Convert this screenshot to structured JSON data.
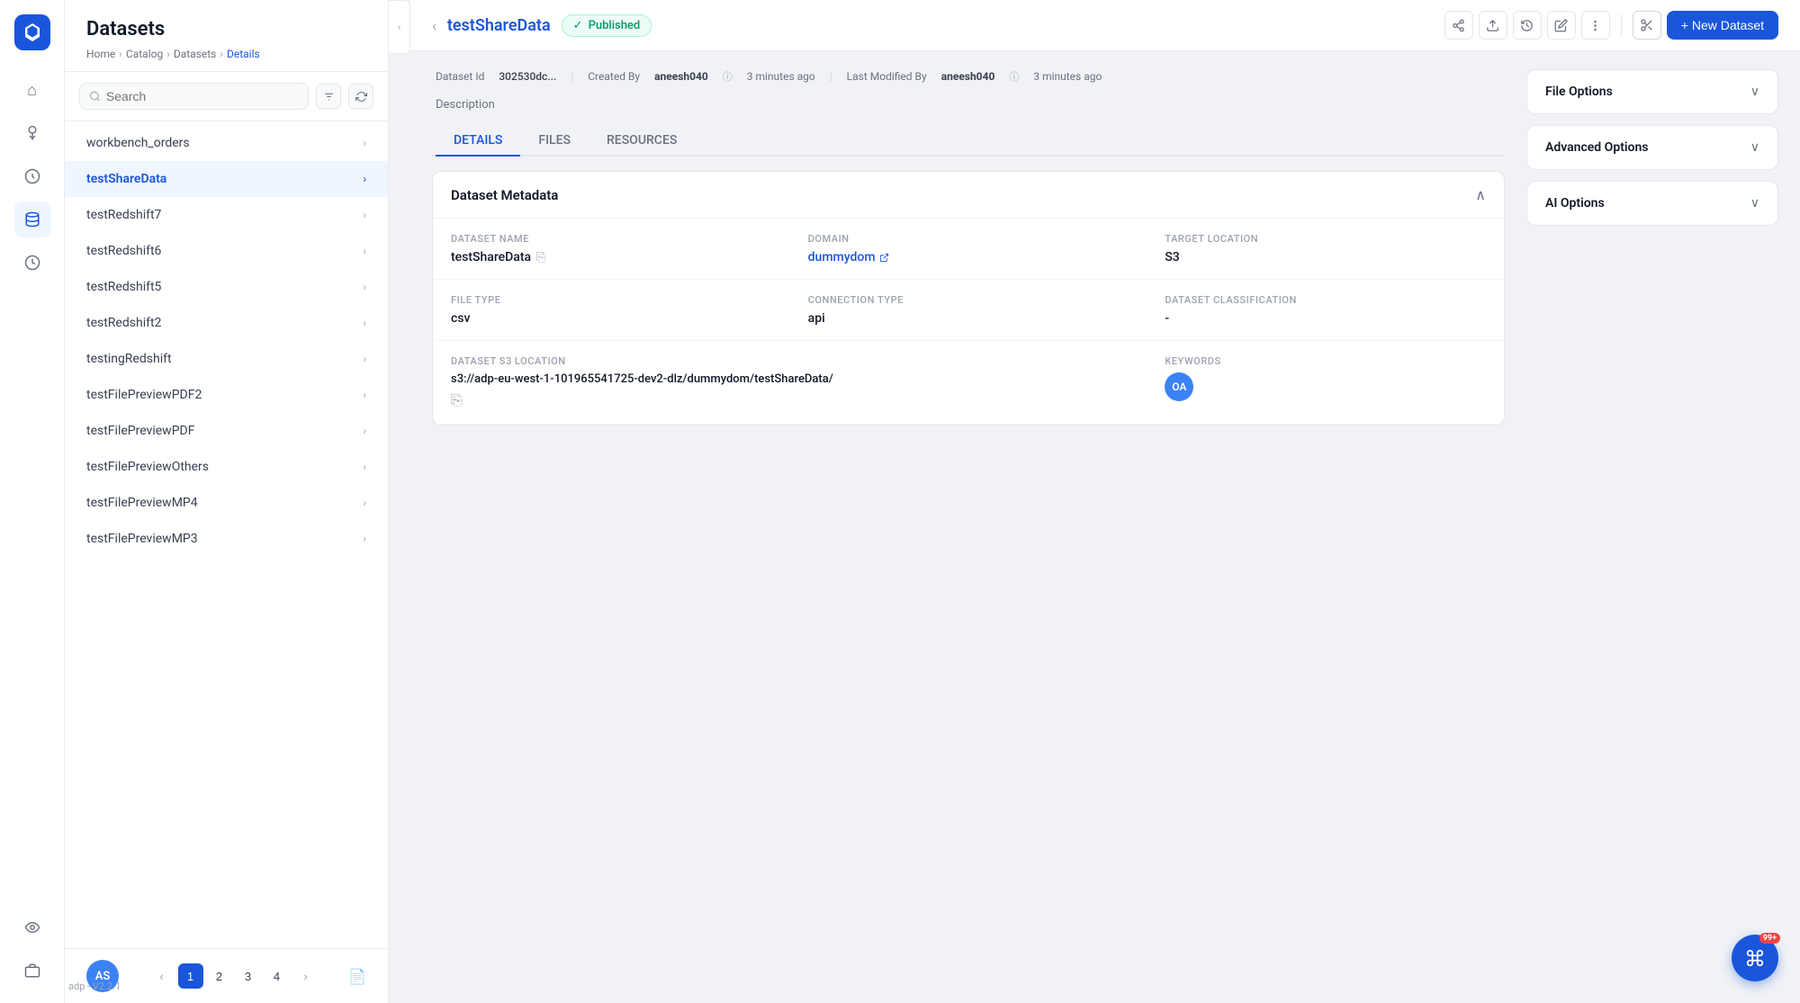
{
  "app": {
    "title": "Datasets",
    "version": "adp - V2.2.1"
  },
  "breadcrumb": {
    "home": "Home",
    "catalog": "Catalog",
    "datasets": "Datasets",
    "details": "Details"
  },
  "sidebar": {
    "nav_icons": [
      {
        "name": "home-icon",
        "symbol": "⌂",
        "active": false
      },
      {
        "name": "filter-icon",
        "symbol": "⚡",
        "active": false
      },
      {
        "name": "chart-icon",
        "symbol": "◎",
        "active": false
      },
      {
        "name": "settings-icon",
        "symbol": "⚙",
        "active": false
      },
      {
        "name": "clock-icon",
        "symbol": "◷",
        "active": false
      },
      {
        "name": "waves-icon",
        "symbol": "≋",
        "active": false
      },
      {
        "name": "database-icon",
        "symbol": "⊞",
        "active": false
      }
    ],
    "user_avatar": "AS"
  },
  "search": {
    "placeholder": "Search",
    "label": "Search"
  },
  "dataset_list": {
    "items": [
      {
        "id": 1,
        "name": "workbench_orders",
        "active": false
      },
      {
        "id": 2,
        "name": "testShareData",
        "active": true
      },
      {
        "id": 3,
        "name": "testRedshift7",
        "active": false
      },
      {
        "id": 4,
        "name": "testRedshift6",
        "active": false
      },
      {
        "id": 5,
        "name": "testRedshift5",
        "active": false
      },
      {
        "id": 6,
        "name": "testRedshift2",
        "active": false
      },
      {
        "id": 7,
        "name": "testingRedshift",
        "active": false
      },
      {
        "id": 8,
        "name": "testFilePreviewPDF2",
        "active": false
      },
      {
        "id": 9,
        "name": "testFilePreviewPDF",
        "active": false
      },
      {
        "id": 10,
        "name": "testFilePreviewOthers",
        "active": false
      },
      {
        "id": 11,
        "name": "testFilePreviewMP4",
        "active": false
      },
      {
        "id": 12,
        "name": "testFilePreviewMP3",
        "active": false
      }
    ]
  },
  "pagination": {
    "current": 1,
    "pages": [
      1,
      2,
      3,
      4
    ]
  },
  "detail": {
    "dataset_name": "testShareData",
    "status": "Published",
    "dataset_id_label": "Dataset Id",
    "dataset_id_value": "302530dc...",
    "created_by_label": "Created By",
    "created_by_user": "aneesh040",
    "created_time": "3 minutes ago",
    "modified_by_label": "Last Modified By",
    "modified_by_user": "aneesh040",
    "modified_time": "3 minutes ago",
    "description_label": "Description",
    "tabs": [
      {
        "id": "details",
        "label": "DETAILS",
        "active": true
      },
      {
        "id": "files",
        "label": "FILES",
        "active": false
      },
      {
        "id": "resources",
        "label": "RESOURCES",
        "active": false
      }
    ]
  },
  "metadata": {
    "title": "Dataset Metadata",
    "fields": {
      "dataset_name_label": "Dataset Name",
      "dataset_name_value": "testShareData",
      "domain_label": "Domain",
      "domain_value": "dummydom",
      "target_location_label": "Target Location",
      "target_location_value": "S3",
      "file_type_label": "File Type",
      "file_type_value": "csv",
      "connection_type_label": "Connection Type",
      "connection_type_value": "api",
      "dataset_classification_label": "Dataset Classification",
      "dataset_classification_value": "-",
      "s3_location_label": "Dataset S3 Location",
      "s3_location_value": "s3://adp-eu-west-1-101965541725-dev2-dlz/dummydom/testShareData/",
      "keywords_label": "Keywords",
      "keywords_badge": "OA"
    }
  },
  "right_panel": {
    "cards": [
      {
        "id": "file-options",
        "label": "File Options",
        "expanded": false
      },
      {
        "id": "advanced-options",
        "label": "Advanced Options",
        "expanded": false
      },
      {
        "id": "ai-options",
        "label": "AI Options",
        "expanded": false
      }
    ]
  },
  "toolbar": {
    "share_icon": "share",
    "upload_icon": "upload",
    "history_icon": "history",
    "edit_icon": "edit",
    "more_icon": "more",
    "new_dataset_label": "+ New Dataset",
    "scissors_icon": "scissors"
  },
  "fab": {
    "badge": "99+"
  }
}
